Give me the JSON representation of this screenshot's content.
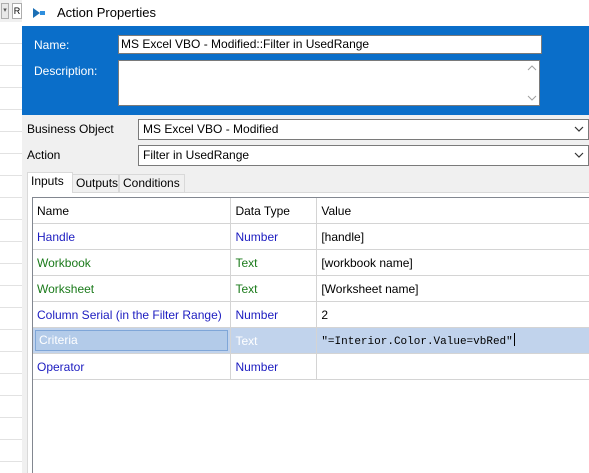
{
  "background": {
    "drop_glyph": "▾",
    "r_label": "R"
  },
  "window": {
    "title": "Action Properties"
  },
  "header": {
    "name_label": "Name:",
    "name_value": "MS Excel VBO - Modified::Filter in UsedRange",
    "description_label": "Description:",
    "description_value": ""
  },
  "business_object": {
    "label": "Business Object",
    "value": "MS Excel VBO - Modified"
  },
  "action": {
    "label": "Action",
    "value": "Filter in UsedRange"
  },
  "tabs": [
    {
      "label": "Inputs",
      "active": true
    },
    {
      "label": "Outputs",
      "active": false
    },
    {
      "label": "Conditions",
      "active": false
    }
  ],
  "grid": {
    "columns": [
      "Name",
      "Data Type",
      "Value"
    ],
    "rows": [
      {
        "name": "Handle",
        "type": "Number",
        "value": "[handle]"
      },
      {
        "name": "Workbook",
        "type": "Text",
        "value": "[workbook name]"
      },
      {
        "name": "Worksheet",
        "type": "Text",
        "value": "[Worksheet name]"
      },
      {
        "name": "Column Serial (in the Filter Range)",
        "type": "Number",
        "value": "2"
      },
      {
        "name": "Criteria",
        "type": "Text",
        "value": "\"=Interior.Color.Value=vbRed\""
      },
      {
        "name": "Operator",
        "type": "Number",
        "value": ""
      }
    ]
  },
  "colors": {
    "header_blue": "#0a6ec9",
    "number_type_blue": "#1c1cc0",
    "text_type_green": "#1a7a1a",
    "selected_row": "#c1d3ec"
  }
}
